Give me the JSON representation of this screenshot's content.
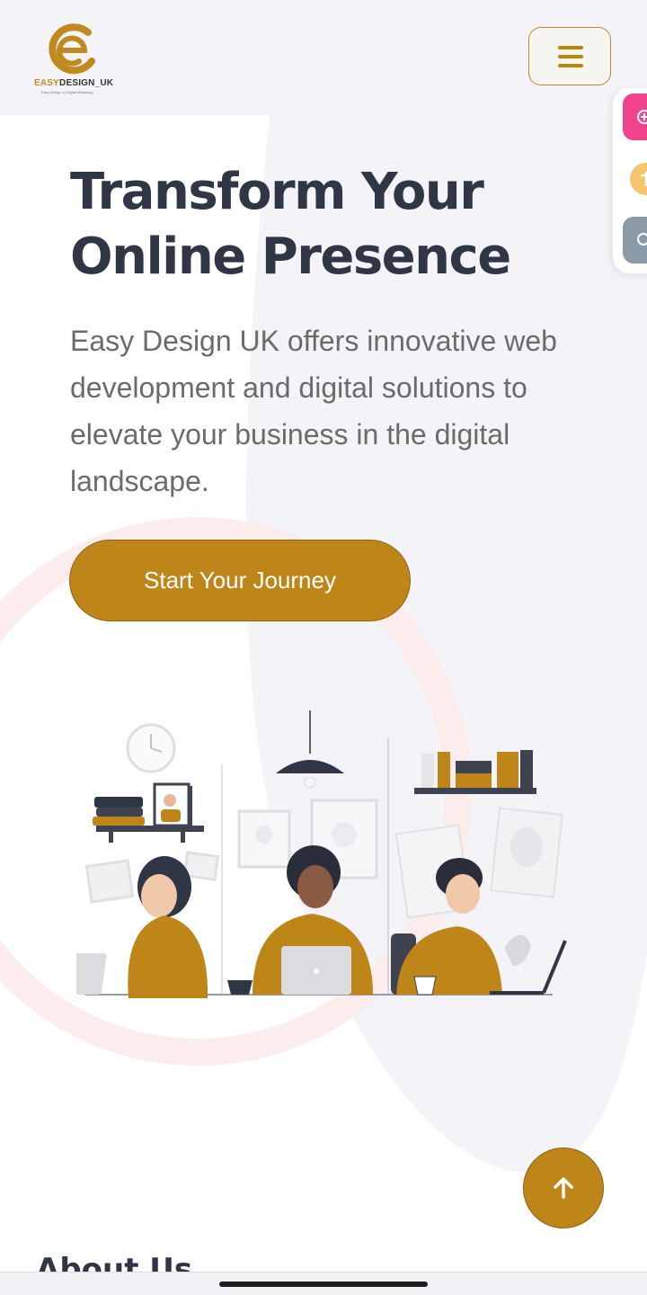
{
  "header": {
    "logo": {
      "brand_prefix": "EASY",
      "brand_suffix": "DESIGN_UK",
      "tagline": "Easy Design in Digital Marketing"
    },
    "menu_icon": "hamburger-icon"
  },
  "side_dock": {
    "items": [
      {
        "icon": "plus-circle-icon",
        "color": "#f0438c"
      },
      {
        "icon": "pin-icon",
        "color": "#f5c46b"
      },
      {
        "icon": "search-icon",
        "color": "#8a9aa6"
      }
    ]
  },
  "hero": {
    "title_line1": "Transform Your",
    "title_line2": "Online Presence",
    "description": "Easy Design UK offers innovative web development and digital solutions to elevate your business in the digital landscape.",
    "cta_label": "Start Your Journey"
  },
  "about": {
    "heading": "About Us"
  },
  "scroll_top": {
    "icon": "arrow-up-icon"
  },
  "colors": {
    "accent": "#be8519",
    "heading": "#2f3646",
    "body_text": "#6b6b6b"
  }
}
